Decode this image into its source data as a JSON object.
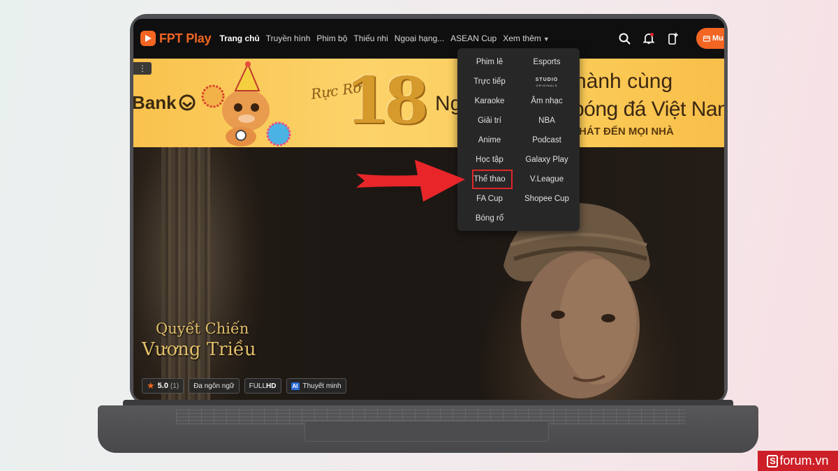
{
  "app": {
    "logo_text": "FPT Play"
  },
  "nav": {
    "items": [
      {
        "label": "Trang chủ",
        "active": true
      },
      {
        "label": "Truyền hình"
      },
      {
        "label": "Phim bộ"
      },
      {
        "label": "Thiếu nhi"
      },
      {
        "label": "Ngoại hạng..."
      },
      {
        "label": "ASEAN Cup"
      }
    ],
    "more_label": "Xem thêm",
    "buy_label": "Mu",
    "icons": [
      "search-icon",
      "bell-icon",
      "device-plus-icon"
    ]
  },
  "banner": {
    "bank_text": "Bank",
    "script_text": "Rực Rỡ",
    "number": "18",
    "headline_part1": "Ng",
    "headline_line1": "hành cùng",
    "headline_line2": "bóng đá Việt Nan",
    "subline": "HÁT ĐẾN MỌI NHÀ"
  },
  "dropdown": {
    "column1": [
      "Phim lẻ",
      "Trực tiếp",
      "Karaoke",
      "Giải trí",
      "Anime",
      "Học tập",
      "Thể thao",
      "FA Cup",
      "Bóng rổ"
    ],
    "column2": [
      "Esports",
      "STUDIO",
      "Âm nhạc",
      "NBA",
      "Podcast",
      "Galaxy Play",
      "V.League",
      "Shopee Cup"
    ],
    "studio_sub": "ORIGINALS",
    "highlighted": "Thể thao"
  },
  "hero": {
    "title_line1": "Quyết Chiến",
    "title_line2": "Vương Triều",
    "rating": "5.0",
    "rating_count": "(1)",
    "tag_languages": "Đa ngôn ngữ",
    "tag_full": "FULL",
    "tag_hd": "HD",
    "tag_ai": "AI",
    "tag_narration": "Thuyết minh"
  },
  "watermark": {
    "s": "S",
    "text": "forum.vn"
  },
  "colors": {
    "brand": "#f26522",
    "highlight": "#e0262a",
    "arrow": "#e8262a"
  }
}
